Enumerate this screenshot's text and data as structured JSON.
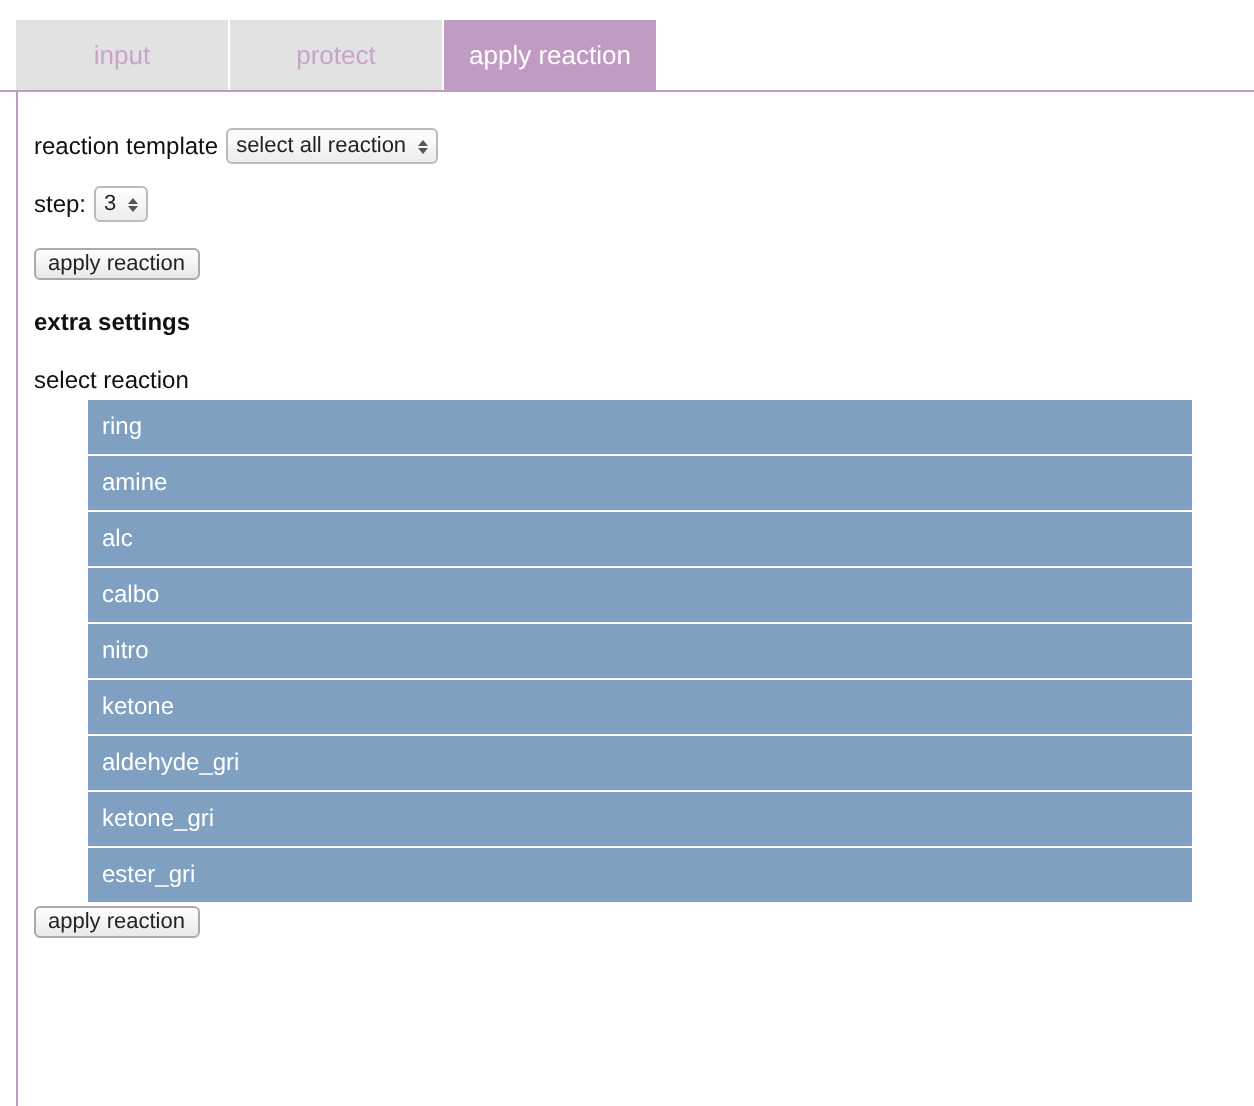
{
  "tabs": [
    {
      "label": "input",
      "selected": false
    },
    {
      "label": "protect",
      "selected": false
    },
    {
      "label": "apply reaction",
      "selected": true
    }
  ],
  "reaction_template": {
    "label": "reaction template",
    "value": "select all reaction"
  },
  "step": {
    "label": "step:",
    "value": "3"
  },
  "apply_button_top": "apply reaction",
  "extra_settings": "extra settings",
  "select_reaction": {
    "label": "select reaction",
    "items": [
      "ring",
      "amine",
      "alc",
      "calbo",
      "nitro",
      "ketone",
      "aldehyde_gri",
      "ketone_gri",
      "ester_gri"
    ]
  },
  "apply_button_bottom": "apply reaction"
}
